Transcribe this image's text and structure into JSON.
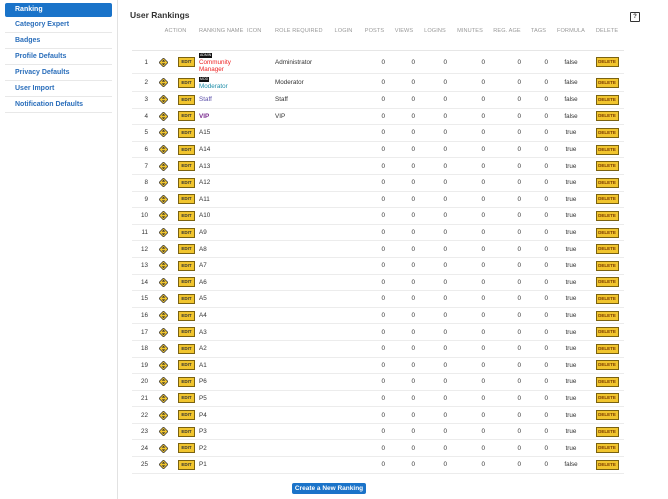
{
  "sidebar": {
    "items": [
      {
        "label": "Ranking",
        "active": true
      },
      {
        "label": "Category Expert"
      },
      {
        "label": "Badges"
      },
      {
        "label": "Profile Defaults"
      },
      {
        "label": "Privacy Defaults"
      },
      {
        "label": "User Import"
      },
      {
        "label": "Notification Defaults"
      }
    ]
  },
  "header": {
    "title": "User Rankings",
    "help_icon": "?"
  },
  "table": {
    "columns": {
      "action": "ACTION",
      "ranking_name": "RANKING NAME",
      "icon": "ICON",
      "role": "ROLE REQUIRED",
      "login": "LOGIN",
      "posts": "POSTS",
      "views": "VIEWS",
      "logins": "LOGINS",
      "minutes": "MINUTES",
      "reg_age": "REG. AGE",
      "tags": "TAGS",
      "formula": "FORMULA",
      "delete": "DELETE"
    },
    "edit_label": "EDIT",
    "delete_label": "DELETE",
    "rows": [
      {
        "idx": "1",
        "name": "Community Manager",
        "badge": "ADMIN",
        "role": "Administrator",
        "posts": "0",
        "views": "0",
        "logins": "0",
        "minutes": "0",
        "reg_age": "0",
        "tags": "0",
        "formula": "false"
      },
      {
        "idx": "2",
        "name": "Moderator",
        "badge": "MOD",
        "role": "Moderator",
        "posts": "0",
        "views": "0",
        "logins": "0",
        "minutes": "0",
        "reg_age": "0",
        "tags": "0",
        "formula": "false"
      },
      {
        "idx": "3",
        "name": "Staff",
        "badge": "",
        "role": "Staff",
        "posts": "0",
        "views": "0",
        "logins": "0",
        "minutes": "0",
        "reg_age": "0",
        "tags": "0",
        "formula": "false"
      },
      {
        "idx": "4",
        "name": "VIP",
        "badge": "",
        "role": "VIP",
        "posts": "0",
        "views": "0",
        "logins": "0",
        "minutes": "0",
        "reg_age": "0",
        "tags": "0",
        "formula": "false"
      },
      {
        "idx": "5",
        "name": "A15",
        "badge": "",
        "role": "",
        "posts": "0",
        "views": "0",
        "logins": "0",
        "minutes": "0",
        "reg_age": "0",
        "tags": "0",
        "formula": "true"
      },
      {
        "idx": "6",
        "name": "A14",
        "badge": "",
        "role": "",
        "posts": "0",
        "views": "0",
        "logins": "0",
        "minutes": "0",
        "reg_age": "0",
        "tags": "0",
        "formula": "true"
      },
      {
        "idx": "7",
        "name": "A13",
        "badge": "",
        "role": "",
        "posts": "0",
        "views": "0",
        "logins": "0",
        "minutes": "0",
        "reg_age": "0",
        "tags": "0",
        "formula": "true"
      },
      {
        "idx": "8",
        "name": "A12",
        "badge": "",
        "role": "",
        "posts": "0",
        "views": "0",
        "logins": "0",
        "minutes": "0",
        "reg_age": "0",
        "tags": "0",
        "formula": "true"
      },
      {
        "idx": "9",
        "name": "A11",
        "badge": "",
        "role": "",
        "posts": "0",
        "views": "0",
        "logins": "0",
        "minutes": "0",
        "reg_age": "0",
        "tags": "0",
        "formula": "true"
      },
      {
        "idx": "10",
        "name": "A10",
        "badge": "",
        "role": "",
        "posts": "0",
        "views": "0",
        "logins": "0",
        "minutes": "0",
        "reg_age": "0",
        "tags": "0",
        "formula": "true"
      },
      {
        "idx": "11",
        "name": "A9",
        "badge": "",
        "role": "",
        "posts": "0",
        "views": "0",
        "logins": "0",
        "minutes": "0",
        "reg_age": "0",
        "tags": "0",
        "formula": "true"
      },
      {
        "idx": "12",
        "name": "A8",
        "badge": "",
        "role": "",
        "posts": "0",
        "views": "0",
        "logins": "0",
        "minutes": "0",
        "reg_age": "0",
        "tags": "0",
        "formula": "true"
      },
      {
        "idx": "13",
        "name": "A7",
        "badge": "",
        "role": "",
        "posts": "0",
        "views": "0",
        "logins": "0",
        "minutes": "0",
        "reg_age": "0",
        "tags": "0",
        "formula": "true"
      },
      {
        "idx": "14",
        "name": "A6",
        "badge": "",
        "role": "",
        "posts": "0",
        "views": "0",
        "logins": "0",
        "minutes": "0",
        "reg_age": "0",
        "tags": "0",
        "formula": "true"
      },
      {
        "idx": "15",
        "name": "A5",
        "badge": "",
        "role": "",
        "posts": "0",
        "views": "0",
        "logins": "0",
        "minutes": "0",
        "reg_age": "0",
        "tags": "0",
        "formula": "true"
      },
      {
        "idx": "16",
        "name": "A4",
        "badge": "",
        "role": "",
        "posts": "0",
        "views": "0",
        "logins": "0",
        "minutes": "0",
        "reg_age": "0",
        "tags": "0",
        "formula": "true"
      },
      {
        "idx": "17",
        "name": "A3",
        "badge": "",
        "role": "",
        "posts": "0",
        "views": "0",
        "logins": "0",
        "minutes": "0",
        "reg_age": "0",
        "tags": "0",
        "formula": "true"
      },
      {
        "idx": "18",
        "name": "A2",
        "badge": "",
        "role": "",
        "posts": "0",
        "views": "0",
        "logins": "0",
        "minutes": "0",
        "reg_age": "0",
        "tags": "0",
        "formula": "true"
      },
      {
        "idx": "19",
        "name": "A1",
        "badge": "",
        "role": "",
        "posts": "0",
        "views": "0",
        "logins": "0",
        "minutes": "0",
        "reg_age": "0",
        "tags": "0",
        "formula": "true"
      },
      {
        "idx": "20",
        "name": "P6",
        "badge": "",
        "role": "",
        "posts": "0",
        "views": "0",
        "logins": "0",
        "minutes": "0",
        "reg_age": "0",
        "tags": "0",
        "formula": "true"
      },
      {
        "idx": "21",
        "name": "P5",
        "badge": "",
        "role": "",
        "posts": "0",
        "views": "0",
        "logins": "0",
        "minutes": "0",
        "reg_age": "0",
        "tags": "0",
        "formula": "true"
      },
      {
        "idx": "22",
        "name": "P4",
        "badge": "",
        "role": "",
        "posts": "0",
        "views": "0",
        "logins": "0",
        "minutes": "0",
        "reg_age": "0",
        "tags": "0",
        "formula": "true"
      },
      {
        "idx": "23",
        "name": "P3",
        "badge": "",
        "role": "",
        "posts": "0",
        "views": "0",
        "logins": "0",
        "minutes": "0",
        "reg_age": "0",
        "tags": "0",
        "formula": "true"
      },
      {
        "idx": "24",
        "name": "P2",
        "badge": "",
        "role": "",
        "posts": "0",
        "views": "0",
        "logins": "0",
        "minutes": "0",
        "reg_age": "0",
        "tags": "0",
        "formula": "true"
      },
      {
        "idx": "25",
        "name": "P1",
        "badge": "",
        "role": "",
        "posts": "0",
        "views": "0",
        "logins": "0",
        "minutes": "0",
        "reg_age": "0",
        "tags": "0",
        "formula": "false"
      }
    ]
  },
  "create_button": "Create a New Ranking",
  "colors": {
    "accent": "#1a73c9",
    "button_yellow": "#f1c52e",
    "admin_name": "#ee2222",
    "mod_name": "#1e8ea8",
    "staff_name": "#5a4ea8",
    "vip_name": "#7a2a8e"
  },
  "icons": {
    "move": "move-arrows-icon",
    "help": "help-icon"
  }
}
